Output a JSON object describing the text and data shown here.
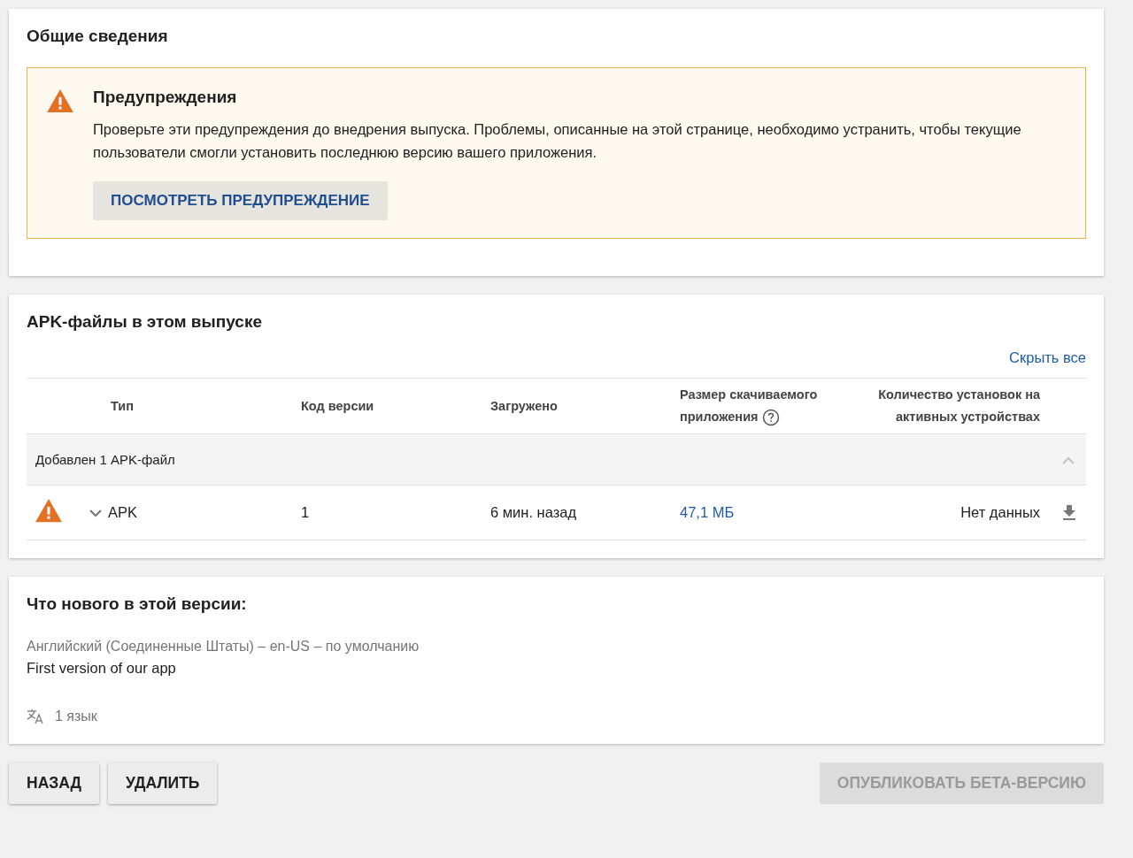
{
  "overview": {
    "title": "Общие сведения",
    "warning": {
      "title": "Предупреждения",
      "text": "Проверьте эти предупреждения до внедрения выпуска. Проблемы, описанные на этой странице, необходимо устранить, чтобы текущие пользователи смогли установить последнюю версию вашего приложения.",
      "button": "ПОСМОТРЕТЬ ПРЕДУПРЕЖДЕНИЕ"
    }
  },
  "apks": {
    "title": "APK-файлы в этом выпуске",
    "hide_all": "Скрыть все",
    "columns": [
      {
        "label": "Тип",
        "help": false
      },
      {
        "label": "Код версии",
        "help": false
      },
      {
        "label": "Загружено",
        "help": false
      },
      {
        "label": "Размер скачиваемого приложения",
        "help": true
      },
      {
        "label": "Количество установок на активных устройствах",
        "help": false
      }
    ],
    "groups": [
      {
        "label": "Добавлен 1 APK-файл",
        "expanded": true,
        "rows": [
          {
            "warning": true,
            "expanded": false,
            "type": "APK",
            "version_code": "1",
            "uploaded": "6 мин. назад",
            "size": "47,1 МБ",
            "installs": "Нет данных"
          }
        ]
      }
    ]
  },
  "whats_new": {
    "title": "Что нового в этой версии:",
    "language": "Английский (Соединенные Штаты) – en-US – по умолчанию",
    "text": "First version of our app",
    "languages_count": "1 язык"
  },
  "actions": {
    "left": [
      {
        "label": "НАЗАД",
        "disabled": false
      },
      {
        "label": "УДАЛИТЬ",
        "disabled": false
      }
    ],
    "right": [
      {
        "label": "ОПУБЛИКОВАТЬ БЕТА-ВЕРСИЮ",
        "disabled": true
      }
    ]
  }
}
